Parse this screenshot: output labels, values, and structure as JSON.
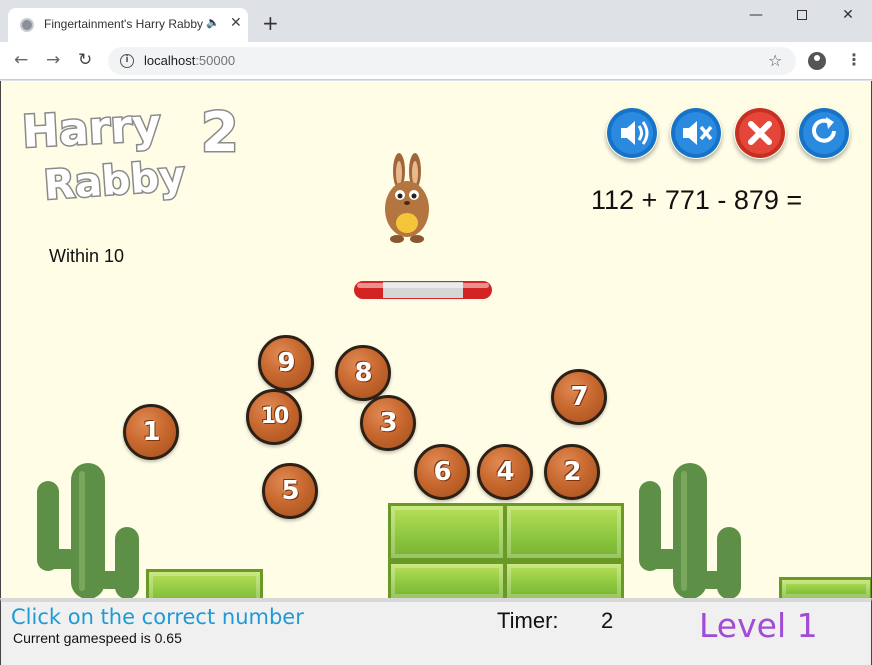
{
  "browser": {
    "tab_title": "Fingertainment's Harry Rabby 2",
    "tab_audio_icon": "speaker-icon",
    "tab_close": "✕",
    "new_tab": "+",
    "address_host": "localhost",
    "address_port": ":50000",
    "window_min": "—",
    "window_close": "✕"
  },
  "game": {
    "logo": {
      "line1": "Harry",
      "line2": "Rabby",
      "number": "2"
    },
    "equation": "112 + 771 - 879 =",
    "range_label": "Within 10",
    "controls": [
      "sound-on",
      "sound-off",
      "close",
      "restart"
    ],
    "balls": [
      "9",
      "8",
      "1",
      "10",
      "3",
      "7",
      "6",
      "4",
      "2",
      "5"
    ],
    "status": {
      "instruction": "Click on the correct number",
      "gamespeed": "Current gamespeed is 0.65",
      "timer_label": "Timer:",
      "timer_value": "2",
      "level": "Level 1"
    },
    "colors": {
      "background": "#fffde6",
      "ball": "#c8692f",
      "control_blue": "#1673c7",
      "control_red": "#d93a2b",
      "instruction": "#1e9bd7",
      "level": "#a24bd6",
      "block": "#8cc63f",
      "cactus": "#5e8f46"
    }
  }
}
